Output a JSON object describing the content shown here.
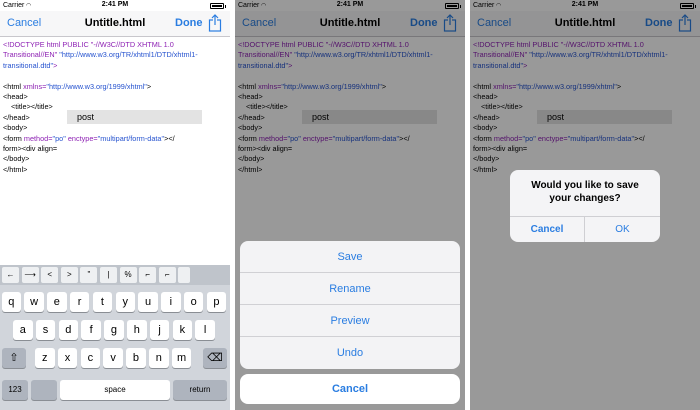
{
  "status": {
    "carrier": "Carrier",
    "time": "2:41 PM"
  },
  "nav": {
    "cancel": "Cancel",
    "title": "Untitle.html",
    "done": "Done",
    "share_icon": "share-icon"
  },
  "code": {
    "l1a": "<!DOCTYPE html PUBLIC \"-//W3C//DTD XHTML 1.0",
    "l2a": "Transitional//EN\" ",
    "l2b": "\"http://www.w3.org/TR/xhtml1/DTD/xhtml1-",
    "l3a": "transitional.dtd\"",
    "l3b": ">",
    "html_open": "<html ",
    "xmlns_attr": "xmlns=",
    "xmlns_val": "\"http://www.w3.org/1999/xhtml\"",
    "gt": ">",
    "head_open": "<head>",
    "title_tags": "<title></title>",
    "head_close": "</head>",
    "body_open": "<body>",
    "form_open": "<form ",
    "method_attr": "method=",
    "method_val": "\"po\"",
    "enctype_attr": " enctype=",
    "enctype_val": "\"multipart/form-data\"",
    "form_tail": "></",
    "form_close2": "form><div align=",
    "body_close": "</body>",
    "html_close": "</html>",
    "post": "post"
  },
  "accessory_keys": [
    "←",
    "⟶",
    "<",
    ">",
    "\"",
    "|",
    "%",
    "⌐",
    "⌐"
  ],
  "keyboard": {
    "row1": [
      "q",
      "w",
      "e",
      "r",
      "t",
      "y",
      "u",
      "i",
      "o",
      "p"
    ],
    "row2": [
      "a",
      "s",
      "d",
      "f",
      "g",
      "h",
      "j",
      "k",
      "l"
    ],
    "row3": [
      "z",
      "x",
      "c",
      "v",
      "b",
      "n",
      "m"
    ],
    "shift_icon": "shift-icon",
    "delete_icon": "delete-icon",
    "num": "123",
    "space": "space",
    "return": "return"
  },
  "action_sheet": {
    "items": [
      "Save",
      "Rename",
      "Preview",
      "Undo"
    ],
    "cancel": "Cancel"
  },
  "alert": {
    "message": "Would you like to save your changes?",
    "cancel": "Cancel",
    "ok": "OK"
  },
  "colors": {
    "accent": "#2a7de1",
    "tag_purple": "#8e22b4",
    "value_blue": "#2653cf"
  }
}
